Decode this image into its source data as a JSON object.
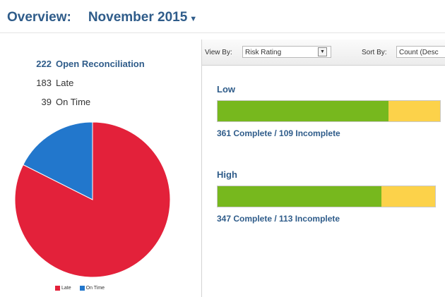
{
  "header": {
    "title": "Overview:",
    "period": "November 2015"
  },
  "summary": {
    "open": {
      "count": "222",
      "label": "Open Reconciliation"
    },
    "late": {
      "count": "183",
      "label": "Late"
    },
    "on_time": {
      "count": "39",
      "label": "On Time"
    }
  },
  "pie": {
    "slices": [
      {
        "name": "Late",
        "value": 183,
        "color": "#e3213a"
      },
      {
        "name": "On Time",
        "value": 39,
        "color": "#2277cc"
      }
    ]
  },
  "legend": {
    "late_label": "Late",
    "on_time_label": "On Time"
  },
  "toolbar": {
    "view_by_label": "View By:",
    "view_by_value": "Risk Rating",
    "sort_by_label": "Sort By:",
    "sort_by_value": "Count (Desc"
  },
  "groups": {
    "low": {
      "title": "Low",
      "complete": 361,
      "incomplete": 109,
      "summary": "361 Complete / 109 Incomplete"
    },
    "high": {
      "title": "High",
      "complete": 347,
      "incomplete": 113,
      "summary": "347 Complete / 113 Incomplete"
    }
  },
  "colors": {
    "accent": "#2f5c8a",
    "complete": "#77b81e",
    "incomplete": "#fcd24a",
    "late": "#e3213a",
    "on_time": "#2277cc"
  }
}
